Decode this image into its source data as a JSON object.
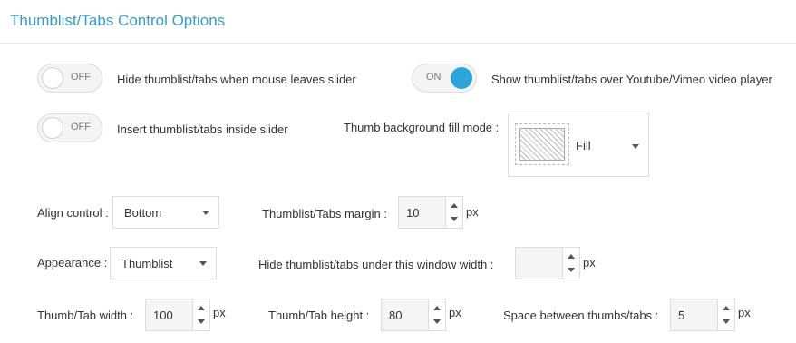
{
  "title": "Thumblist/Tabs Control Options",
  "toggles": {
    "hide_on_leave": {
      "state": "OFF",
      "label": "Hide thumblist/tabs when mouse leaves slider"
    },
    "show_over_video": {
      "state": "ON",
      "label": "Show thumblist/tabs over Youtube/Vimeo video player"
    },
    "insert_inside": {
      "state": "OFF",
      "label": "Insert thumblist/tabs inside slider"
    }
  },
  "fill_mode": {
    "label": "Thumb background fill mode :",
    "value": "Fill"
  },
  "align": {
    "label": "Align control :",
    "value": "Bottom"
  },
  "margin": {
    "label": "Thumblist/Tabs margin :",
    "value": "10",
    "unit": "px"
  },
  "appearance": {
    "label": "Appearance :",
    "value": "Thumblist"
  },
  "hide_width": {
    "label": "Hide thumblist/tabs under this window width :",
    "value": "",
    "unit": "px"
  },
  "thumb_width": {
    "label": "Thumb/Tab width :",
    "value": "100",
    "unit": "px"
  },
  "thumb_height": {
    "label": "Thumb/Tab height :",
    "value": "80",
    "unit": "px"
  },
  "spacing": {
    "label": "Space between thumbs/tabs :",
    "value": "5",
    "unit": "px"
  },
  "colors": {
    "accent": "#3a9bc9",
    "toggle_on": "#2ea5d8"
  }
}
